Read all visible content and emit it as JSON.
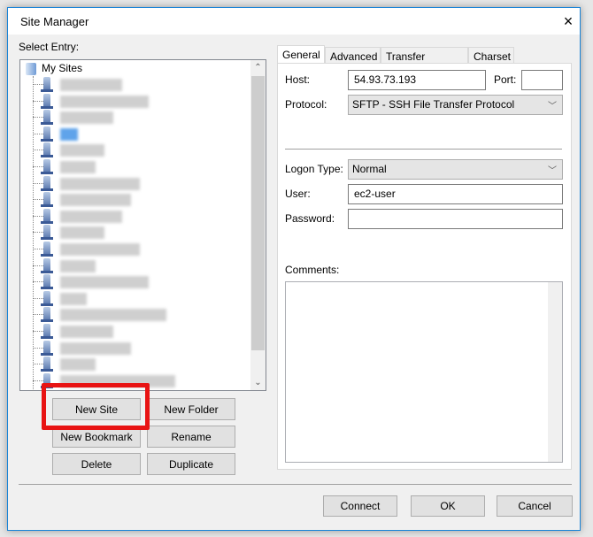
{
  "window": {
    "title": "Site Manager",
    "close_icon": "×"
  },
  "left": {
    "select_label": "Select Entry:",
    "root": "My Sites",
    "site_count": 19
  },
  "buttons": {
    "new_site": "New Site",
    "new_folder": "New Folder",
    "new_bookmark": "New Bookmark",
    "rename": "Rename",
    "delete": "Delete",
    "duplicate": "Duplicate"
  },
  "tabs": [
    "General",
    "Advanced",
    "Transfer Settings",
    "Charset"
  ],
  "general": {
    "host_label": "Host:",
    "host": "54.93.73.193",
    "port_label": "Port:",
    "port": "",
    "protocol_label": "Protocol:",
    "protocol": "SFTP - SSH File Transfer Protocol",
    "logon_label": "Logon Type:",
    "logon": "Normal",
    "user_label": "User:",
    "user": "ec2-user",
    "password_label": "Password:",
    "password": "",
    "comments_label": "Comments:",
    "comments": ""
  },
  "footer": {
    "connect": "Connect",
    "ok": "OK",
    "cancel": "Cancel"
  },
  "highlight_color": "#e81313"
}
